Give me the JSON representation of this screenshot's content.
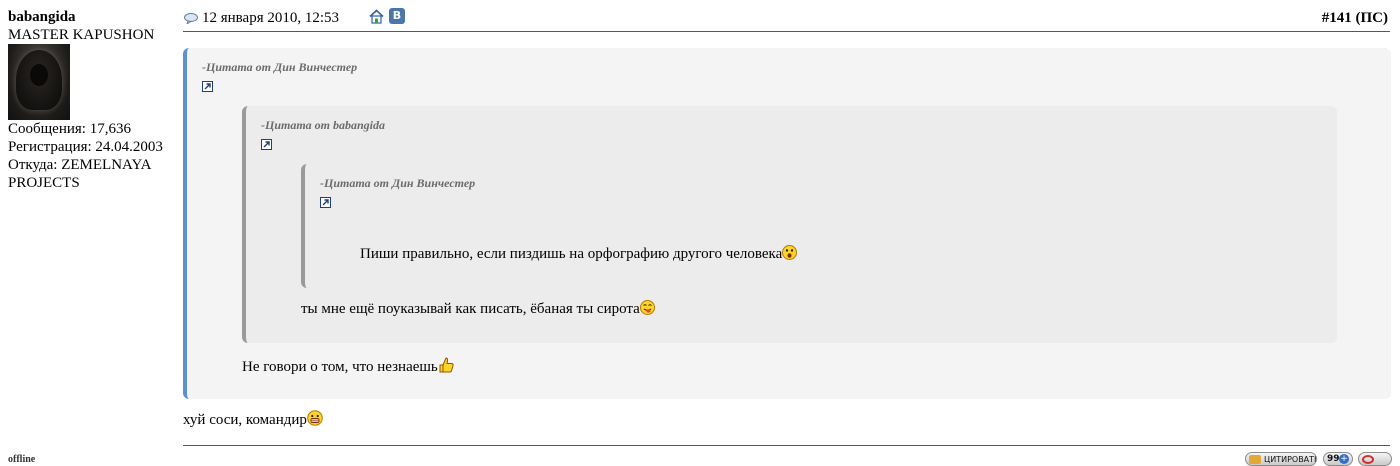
{
  "user": {
    "name": "babangida",
    "title": "MASTER KAPUSHON",
    "posts": "Сообщения: 17,636",
    "registered": "Регистрация: 24.04.2003",
    "from_line1": "Откуда: ZEMELNAYA",
    "from_line2": "PROJECTS",
    "status": "offline"
  },
  "header": {
    "date": "12 января 2010, 12:53",
    "post_number": "#141",
    "post_suffix": "(ПС)",
    "vk_label": "В"
  },
  "quotes": {
    "level1": {
      "author": "-Цитата от Дин Винчестер",
      "text": "Не говори о том, что незнаешь"
    },
    "level2": {
      "author": "-Цитата от babangida",
      "text": "ты мне ещё поуказывай как писать, ёбаная ты сирота"
    },
    "level3": {
      "author": "-Цитата от Дин Винчестер",
      "text": "Пиши правильно, если пиздишь на орфографию другого человека"
    }
  },
  "message": {
    "text": "хуй соси, командир"
  },
  "buttons": {
    "quote_label": "ЦИТИРОВАТЬ",
    "multiquote_label": "99"
  },
  "icons": {
    "post": "speech-bubble-icon",
    "home": "home-icon",
    "vk": "vk-icon",
    "quote_link": "view-post-arrow-icon"
  },
  "colors": {
    "quote_border_outer": "#5b92d6",
    "quote_border_inner": "#9a9a9a",
    "divider": "#4a5a73"
  }
}
